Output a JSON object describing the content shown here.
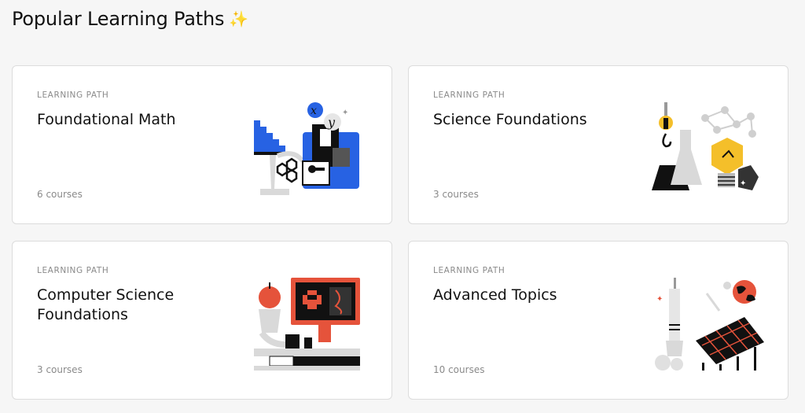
{
  "header": {
    "title": "Popular Learning Paths",
    "title_icon": "sparkles-icon"
  },
  "cards": [
    {
      "eyebrow": "LEARNING PATH",
      "title": "Foundational Math",
      "count": "6 courses",
      "illustration": "math-illustration"
    },
    {
      "eyebrow": "LEARNING PATH",
      "title": "Science Foundations",
      "count": "3 courses",
      "illustration": "science-illustration"
    },
    {
      "eyebrow": "LEARNING PATH",
      "title": "Computer Science Foundations",
      "count": "3 courses",
      "illustration": "computer-science-illustration"
    },
    {
      "eyebrow": "LEARNING PATH",
      "title": "Advanced Topics",
      "count": "10 courses",
      "illustration": "advanced-topics-illustration"
    }
  ],
  "colors": {
    "blue": "#2762e3",
    "yellow": "#f4bf2a",
    "red": "#e5533b",
    "dark": "#111111",
    "gray": "#d9d9d9"
  }
}
